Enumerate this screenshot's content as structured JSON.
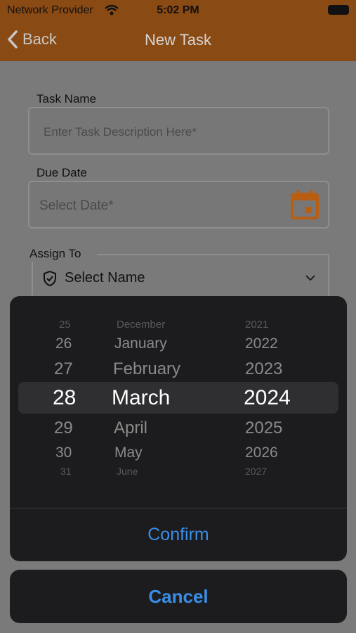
{
  "status_bar": {
    "carrier": "Network Provider",
    "time": "5:02 PM"
  },
  "nav": {
    "back_label": "Back",
    "title": "New Task"
  },
  "form": {
    "task_name_label": "Task Name",
    "task_name_placeholder": "Enter Task Description Here*",
    "due_date_label": "Due Date",
    "due_date_placeholder": "Select Date*",
    "assign_to_label": "Assign To",
    "assign_to_value": "Select Name"
  },
  "picker": {
    "days": [
      "25",
      "26",
      "27",
      "28",
      "29",
      "30",
      "31"
    ],
    "months": [
      "December",
      "January",
      "February",
      "March",
      "April",
      "May",
      "June"
    ],
    "years": [
      "2021",
      "2022",
      "2023",
      "2024",
      "2025",
      "2026",
      "2027"
    ],
    "selected": {
      "day": "28",
      "month": "March",
      "year": "2024"
    },
    "confirm_label": "Confirm"
  },
  "cancel_label": "Cancel",
  "colors": {
    "header": "#8a4a14",
    "accent": "#3a8ee6",
    "calendar_icon": "#b85e12"
  }
}
